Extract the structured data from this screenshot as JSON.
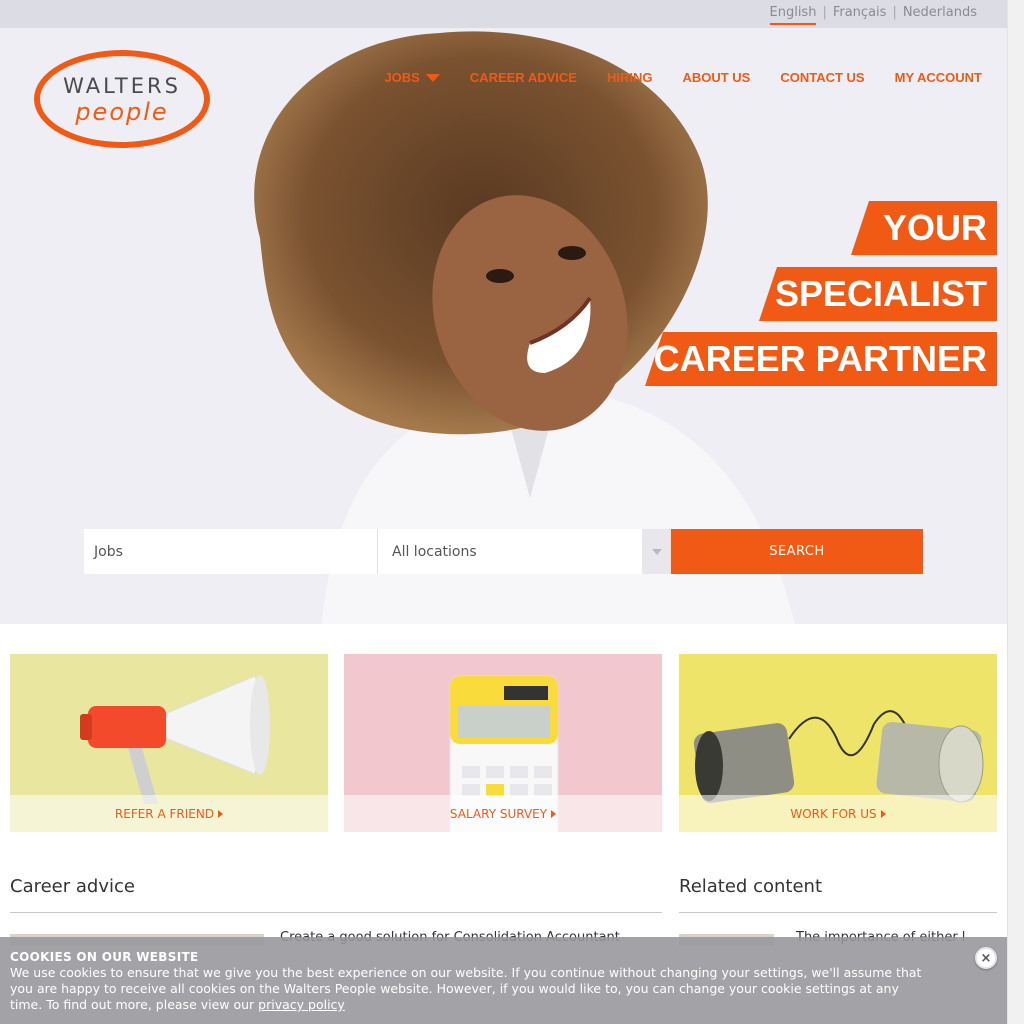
{
  "languages": [
    {
      "label": "English",
      "active": true
    },
    {
      "label": "Français",
      "active": false
    },
    {
      "label": "Nederlands",
      "active": false
    }
  ],
  "logo": {
    "line1": "WALTERS",
    "line2": "people"
  },
  "nav": {
    "jobs": "JOBS",
    "career_advice": "CAREER ADVICE",
    "hiring": "HIRING",
    "about_us": "ABOUT US",
    "contact_us": "CONTACT US",
    "my_account": "MY ACCOUNT"
  },
  "hero": {
    "line1": "YOUR",
    "line2": "SPECIALIST",
    "line3": "CAREER PARTNER"
  },
  "search": {
    "jobs_placeholder": "Jobs",
    "location_value": "All locations",
    "button": "SEARCH"
  },
  "cards": [
    {
      "label": "REFER A FRIEND",
      "icon": "megaphone"
    },
    {
      "label": "SALARY SURVEY",
      "icon": "calculator"
    },
    {
      "label": "WORK FOR US",
      "icon": "tin-can-phone"
    }
  ],
  "sections": {
    "career_advice": "Career advice",
    "related_content": "Related content",
    "career_snippet": "Create a good solution for Consolidation Accountant",
    "related_snippet": "The importance of either l"
  },
  "cookie": {
    "title": "COOKIES ON OUR WEBSITE",
    "text": "We use cookies to ensure that we give you the best experience on our website. If you continue without changing your settings, we'll assume that you are happy to receive all cookies on the Walters People website. However, if you would like to, you can change your cookie settings at any time. To find out more, please view our ",
    "link": "privacy policy",
    "close": "×"
  },
  "colors": {
    "accent": "#f05a14",
    "topbar": "#dcdce4",
    "hero_bg": "#efeef4"
  }
}
